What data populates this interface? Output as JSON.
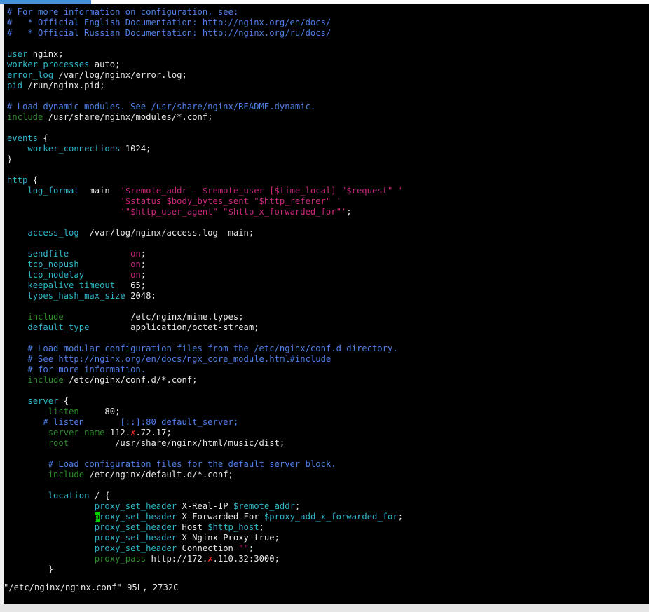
{
  "window": {
    "accent_color": "#4a90d9",
    "background": "#000000"
  },
  "colors": {
    "comment": "#4f7fe8",
    "keyword": "#2fb7c8",
    "keyword_dim": "#2d8a2d",
    "value": "#c8287a",
    "text": "#e8e8e8",
    "cursor": "#00d000",
    "redaction_mark": "#ff2a2a"
  },
  "editor": {
    "lines": [
      [
        {
          "t": "# For more information on configuration, see:",
          "c": "com"
        }
      ],
      [
        {
          "t": "#   * Official English Documentation: http://nginx.org/en/docs/",
          "c": "com"
        }
      ],
      [
        {
          "t": "#   * Official Russian Documentation: http://nginx.org/ru/docs/",
          "c": "com"
        }
      ],
      [],
      [
        {
          "t": "user",
          "c": "kw"
        },
        {
          "t": " nginx;",
          "c": "txt"
        }
      ],
      [
        {
          "t": "worker_processes",
          "c": "kw"
        },
        {
          "t": " auto;",
          "c": "txt"
        }
      ],
      [
        {
          "t": "error_log",
          "c": "kw"
        },
        {
          "t": " /var/log/nginx/error.log;",
          "c": "txt"
        }
      ],
      [
        {
          "t": "pid",
          "c": "kw"
        },
        {
          "t": " /run/nginx.pid;",
          "c": "txt"
        }
      ],
      [],
      [
        {
          "t": "# Load dynamic modules. See /usr/share/nginx/README.dynamic.",
          "c": "com"
        }
      ],
      [
        {
          "t": "include",
          "c": "kwd"
        },
        {
          "t": " /usr/share/nginx/modules/*.conf;",
          "c": "txt"
        }
      ],
      [],
      [
        {
          "t": "events",
          "c": "kw"
        },
        {
          "t": " {",
          "c": "txt"
        }
      ],
      [
        {
          "t": "    ",
          "c": "txt"
        },
        {
          "t": "worker_connections",
          "c": "kw"
        },
        {
          "t": " 1024;",
          "c": "txt"
        }
      ],
      [
        {
          "t": "}",
          "c": "txt"
        }
      ],
      [],
      [
        {
          "t": "http",
          "c": "kw"
        },
        {
          "t": " {",
          "c": "txt"
        }
      ],
      [
        {
          "t": "    ",
          "c": "txt"
        },
        {
          "t": "log_format",
          "c": "kw"
        },
        {
          "t": "  main  ",
          "c": "txt"
        },
        {
          "t": "'$remote_addr - $remote_user [$time_local] \"$request\" '",
          "c": "str"
        }
      ],
      [
        {
          "t": "                      ",
          "c": "txt"
        },
        {
          "t": "'$status $body_bytes_sent \"$http_referer\" '",
          "c": "str"
        }
      ],
      [
        {
          "t": "                      ",
          "c": "txt"
        },
        {
          "t": "'\"$http_user_agent\" \"$http_x_forwarded_for\"'",
          "c": "str"
        },
        {
          "t": ";",
          "c": "txt"
        }
      ],
      [],
      [
        {
          "t": "    ",
          "c": "txt"
        },
        {
          "t": "access_log",
          "c": "kw"
        },
        {
          "t": "  /var/log/nginx/access.log  main;",
          "c": "txt"
        }
      ],
      [],
      [
        {
          "t": "    ",
          "c": "txt"
        },
        {
          "t": "sendfile",
          "c": "kw"
        },
        {
          "t": "            ",
          "c": "txt"
        },
        {
          "t": "on",
          "c": "val"
        },
        {
          "t": ";",
          "c": "txt"
        }
      ],
      [
        {
          "t": "    ",
          "c": "txt"
        },
        {
          "t": "tcp_nopush",
          "c": "kw"
        },
        {
          "t": "          ",
          "c": "txt"
        },
        {
          "t": "on",
          "c": "val"
        },
        {
          "t": ";",
          "c": "txt"
        }
      ],
      [
        {
          "t": "    ",
          "c": "txt"
        },
        {
          "t": "tcp_nodelay",
          "c": "kw"
        },
        {
          "t": "         ",
          "c": "txt"
        },
        {
          "t": "on",
          "c": "val"
        },
        {
          "t": ";",
          "c": "txt"
        }
      ],
      [
        {
          "t": "    ",
          "c": "txt"
        },
        {
          "t": "keepalive_timeout",
          "c": "kw"
        },
        {
          "t": "   65;",
          "c": "txt"
        }
      ],
      [
        {
          "t": "    ",
          "c": "txt"
        },
        {
          "t": "types_hash_max_size",
          "c": "kw"
        },
        {
          "t": " 2048;",
          "c": "txt"
        }
      ],
      [],
      [
        {
          "t": "    ",
          "c": "txt"
        },
        {
          "t": "include",
          "c": "kwd"
        },
        {
          "t": "             /etc/nginx/mime.types;",
          "c": "txt"
        }
      ],
      [
        {
          "t": "    ",
          "c": "txt"
        },
        {
          "t": "default_type",
          "c": "kw"
        },
        {
          "t": "        application/octet-stream;",
          "c": "txt"
        }
      ],
      [],
      [
        {
          "t": "    # Load modular configuration files from the /etc/nginx/conf.d directory.",
          "c": "com"
        }
      ],
      [
        {
          "t": "    # See http://nginx.org/en/docs/ngx_core_module.html#include",
          "c": "com"
        }
      ],
      [
        {
          "t": "    # for more information.",
          "c": "com"
        }
      ],
      [
        {
          "t": "    ",
          "c": "txt"
        },
        {
          "t": "include",
          "c": "kwd"
        },
        {
          "t": " /etc/nginx/conf.d/*.conf;",
          "c": "txt"
        }
      ],
      [],
      [
        {
          "t": "    ",
          "c": "txt"
        },
        {
          "t": "server",
          "c": "kw"
        },
        {
          "t": " {",
          "c": "txt"
        }
      ],
      [
        {
          "t": "        ",
          "c": "txt"
        },
        {
          "t": "listen",
          "c": "kwd"
        },
        {
          "t": "     80;",
          "c": "txt"
        }
      ],
      [
        {
          "t": "       # listen       [::]:80 default_server;",
          "c": "com"
        }
      ],
      [
        {
          "t": "        ",
          "c": "txt"
        },
        {
          "t": "server_name",
          "c": "kwd"
        },
        {
          "t": " 112.",
          "c": "txt"
        },
        {
          "t": "✗",
          "c": "mark"
        },
        {
          "t": ".72.17;",
          "c": "txt"
        }
      ],
      [
        {
          "t": "        ",
          "c": "txt"
        },
        {
          "t": "root",
          "c": "kwd"
        },
        {
          "t": "         /usr/share/nginx/html/music/dist;",
          "c": "txt"
        }
      ],
      [],
      [
        {
          "t": "        # Load configuration files for the default server block.",
          "c": "com"
        }
      ],
      [
        {
          "t": "        ",
          "c": "txt"
        },
        {
          "t": "include",
          "c": "kwd"
        },
        {
          "t": " /etc/nginx/default.d/*.conf;",
          "c": "txt"
        }
      ],
      [],
      [
        {
          "t": "        ",
          "c": "txt"
        },
        {
          "t": "location",
          "c": "kw"
        },
        {
          "t": " / {",
          "c": "txt"
        }
      ],
      [
        {
          "t": "                 ",
          "c": "txt"
        },
        {
          "t": "proxy_set_header",
          "c": "kw"
        },
        {
          "t": " X-Real-IP ",
          "c": "txt"
        },
        {
          "t": "$remote_addr",
          "c": "kw"
        },
        {
          "t": ";",
          "c": "txt"
        }
      ],
      [
        {
          "t": "                 ",
          "c": "txt"
        },
        {
          "t": "p",
          "c": "cursor"
        },
        {
          "t": "roxy_set_header",
          "c": "kw"
        },
        {
          "t": " X-Forwarded-For ",
          "c": "txt"
        },
        {
          "t": "$proxy_add_x_forwarded_for",
          "c": "kw"
        },
        {
          "t": ";",
          "c": "txt"
        }
      ],
      [
        {
          "t": "                 ",
          "c": "txt"
        },
        {
          "t": "proxy_set_header",
          "c": "kw"
        },
        {
          "t": " Host ",
          "c": "txt"
        },
        {
          "t": "$http_host",
          "c": "kw"
        },
        {
          "t": ";",
          "c": "txt"
        }
      ],
      [
        {
          "t": "                 ",
          "c": "txt"
        },
        {
          "t": "proxy_set_header",
          "c": "kw"
        },
        {
          "t": " X-Nginx-Proxy true;",
          "c": "txt"
        }
      ],
      [
        {
          "t": "                 ",
          "c": "txt"
        },
        {
          "t": "proxy_set_header",
          "c": "kw"
        },
        {
          "t": " Connection ",
          "c": "txt"
        },
        {
          "t": "\"\"",
          "c": "str"
        },
        {
          "t": ";",
          "c": "txt"
        }
      ],
      [
        {
          "t": "                 ",
          "c": "txt"
        },
        {
          "t": "proxy_pass",
          "c": "kwd"
        },
        {
          "t": " http://172.",
          "c": "txt"
        },
        {
          "t": "✗",
          "c": "mark"
        },
        {
          "t": ".110.32:3000;",
          "c": "txt"
        }
      ],
      [
        {
          "t": "        }",
          "c": "txt"
        }
      ]
    ]
  },
  "status": {
    "text": "\"/etc/nginx/nginx.conf\" 95L, 2732C"
  }
}
